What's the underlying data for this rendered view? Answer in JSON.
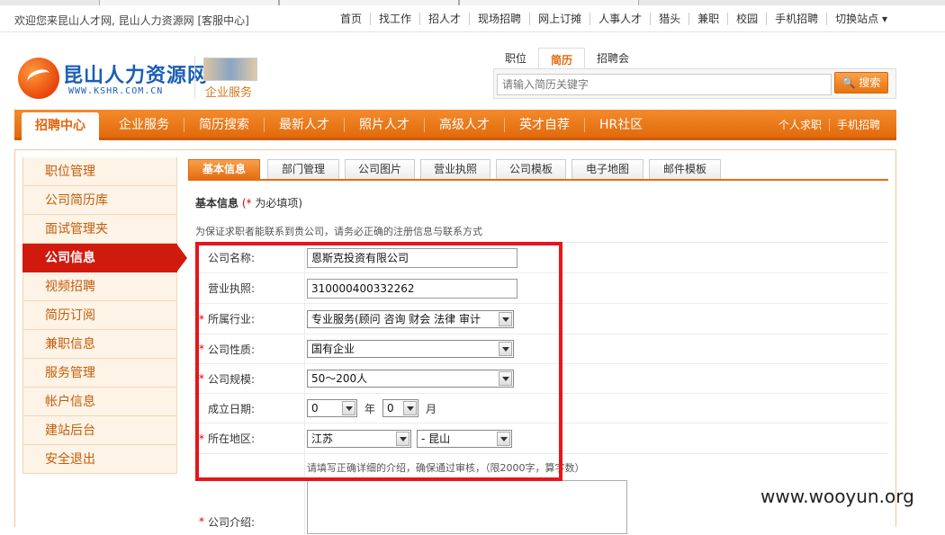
{
  "topbar": {
    "welcome": "欢迎您来昆山人才网, 昆山人力资源网 [客服中心]",
    "links": [
      "首页",
      "找工作",
      "招人才",
      "现场招聘",
      "网上订摊",
      "人事人才",
      "猎头",
      "兼职",
      "校园",
      "手机招聘",
      "切换站点 ▾"
    ]
  },
  "logo": {
    "name": "昆山人力资源网",
    "url": "WWW.KSHR.COM.CN"
  },
  "enterprise": {
    "label": "企业服务"
  },
  "search": {
    "tabs": [
      "职位",
      "简历",
      "招聘会"
    ],
    "active_tab": "简历",
    "placeholder": "请输入简历关键字",
    "button": "🔍 搜索"
  },
  "mainnav": {
    "active": "招聘中心",
    "items": [
      "企业服务",
      "简历搜索",
      "最新人才",
      "照片人才",
      "高级人才",
      "英才自荐",
      "HR社区"
    ],
    "right": [
      "个人求职",
      "手机招聘"
    ]
  },
  "sidebar": {
    "items": [
      "职位管理",
      "公司简历库",
      "面试管理夹",
      "公司信息",
      "视频招聘",
      "简历订阅",
      "兼职信息",
      "服务管理",
      "帐户信息",
      "建站后台",
      "安全退出"
    ],
    "active": "公司信息"
  },
  "tabs": {
    "items": [
      "基本信息",
      "部门管理",
      "公司图片",
      "营业执照",
      "公司模板",
      "电子地图",
      "邮件模板"
    ],
    "active": "基本信息"
  },
  "section": {
    "title": "基本信息",
    "required_mark": "(*",
    "required_text": "为必填项)",
    "notice": "为保证求职者能联系到贵公司，请务必正确的注册信息与联系方式"
  },
  "form": {
    "company_name": {
      "label": "公司名称:",
      "value": "恩斯克投资有限公司"
    },
    "license": {
      "label": "营业执照:",
      "value": "310000400332262"
    },
    "industry": {
      "label": "所属行业:",
      "value": "专业服务(顾问 咨询 财会 法律 审计"
    },
    "nature": {
      "label": "公司性质:",
      "value": "国有企业"
    },
    "scale": {
      "label": "公司规模:",
      "value": "50～200人"
    },
    "founded": {
      "label": "成立日期:",
      "year": "0",
      "year_unit": "年",
      "month": "0",
      "month_unit": "月"
    },
    "region": {
      "label": "所在地区:",
      "province": "江苏",
      "city": "- 昆山"
    },
    "intro_hint": "请填写正确详细的介绍，确保通过审核，（限2000字，算字数）",
    "intro": {
      "label": "公司介绍:"
    }
  },
  "watermark": "www.wooyun.org",
  "colors": {
    "accent": "#e8720f",
    "active_sidebar": "#d11a0e",
    "highlight_box": "#e8141c"
  }
}
